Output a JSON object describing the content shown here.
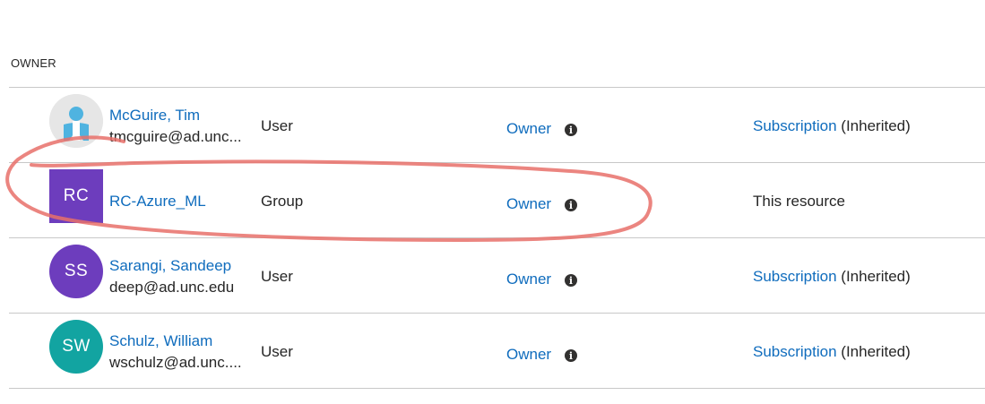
{
  "section": {
    "title": "OWNER"
  },
  "colors": {
    "link": "#0f6cbd",
    "text": "#262626",
    "divider": "#c8c8c8",
    "annotation": "#e8706a"
  },
  "rows": [
    {
      "avatar": {
        "kind": "person-icon",
        "initials": "",
        "color": "#e6e6e6"
      },
      "name": "McGuire, Tim",
      "email": "tmcguire@ad.unc...",
      "type": "User",
      "role": "Owner",
      "scope_link": "Subscription",
      "scope_suffix": " (Inherited)",
      "scope_text": ""
    },
    {
      "avatar": {
        "kind": "square",
        "initials": "RC",
        "color": "#6d3dbd"
      },
      "name": "RC-Azure_ML",
      "email": "",
      "type": "Group",
      "role": "Owner",
      "scope_link": "",
      "scope_suffix": "",
      "scope_text": "This resource"
    },
    {
      "avatar": {
        "kind": "round",
        "initials": "SS",
        "color": "#6d3dbd"
      },
      "name": "Sarangi, Sandeep",
      "email": "deep@ad.unc.edu",
      "type": "User",
      "role": "Owner",
      "scope_link": "Subscription",
      "scope_suffix": " (Inherited)",
      "scope_text": ""
    },
    {
      "avatar": {
        "kind": "round",
        "initials": "SW",
        "color": "#12a4a1"
      },
      "name": "Schulz, William",
      "email": "wschulz@ad.unc....",
      "type": "User",
      "role": "Owner",
      "scope_link": "Subscription",
      "scope_suffix": " (Inherited)",
      "scope_text": ""
    }
  ]
}
